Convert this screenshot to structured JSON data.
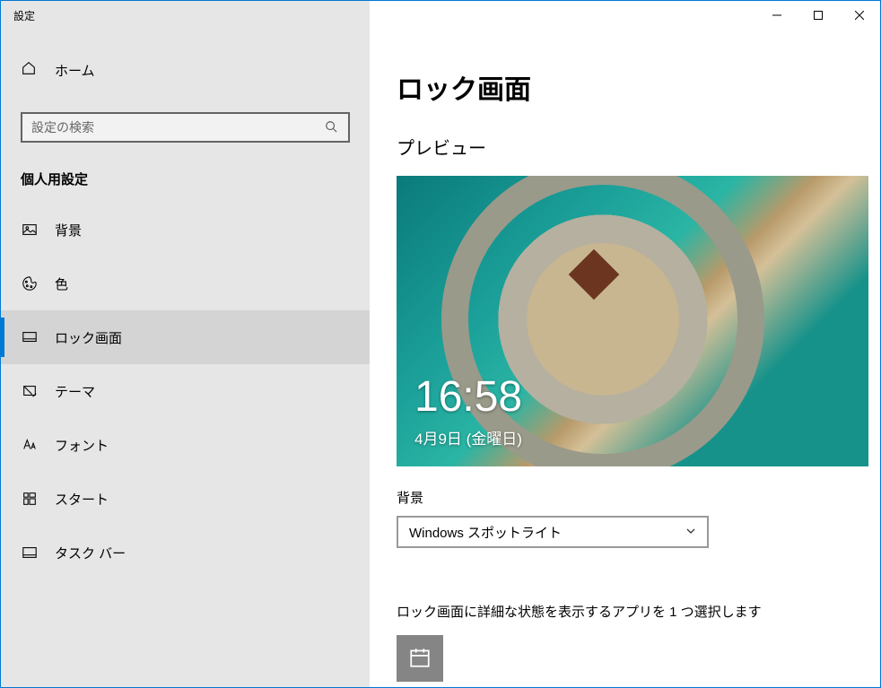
{
  "window": {
    "title": "設定"
  },
  "sidebar": {
    "home_label": "ホーム",
    "search_placeholder": "設定の検索",
    "section_title": "個人用設定",
    "items": [
      {
        "label": "背景",
        "name": "sidebar-item-background"
      },
      {
        "label": "色",
        "name": "sidebar-item-colors"
      },
      {
        "label": "ロック画面",
        "name": "sidebar-item-lockscreen"
      },
      {
        "label": "テーマ",
        "name": "sidebar-item-themes"
      },
      {
        "label": "フォント",
        "name": "sidebar-item-fonts"
      },
      {
        "label": "スタート",
        "name": "sidebar-item-start"
      },
      {
        "label": "タスク バー",
        "name": "sidebar-item-taskbar"
      }
    ]
  },
  "main": {
    "title": "ロック画面",
    "preview_label": "プレビュー",
    "preview": {
      "time": "16:58",
      "date": "4月9日 (金曜日)"
    },
    "background_label": "背景",
    "background_dropdown": {
      "selected": "Windows スポットライト"
    },
    "detail_app_label": "ロック画面に詳細な状態を表示するアプリを 1 つ選択します"
  }
}
